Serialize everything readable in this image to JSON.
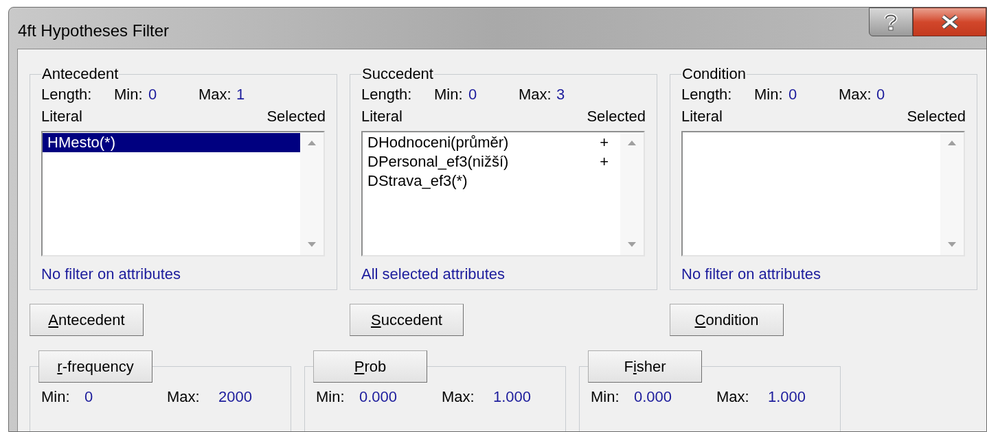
{
  "window": {
    "title": "4ft Hypotheses Filter"
  },
  "title_buttons": [
    {
      "kind": "help"
    },
    {
      "kind": "close"
    }
  ],
  "groups": [
    {
      "title": "Antecedent",
      "length_label": "Length:",
      "min_label": "Min:",
      "min": "0",
      "max_label": "Max:",
      "max": "1",
      "literal_header": "Literal",
      "selected_header": "Selected",
      "items": [
        {
          "literal": "HMesto(*)",
          "selected": true
        }
      ],
      "filter": "No filter on attributes",
      "button": {
        "key": "A",
        "after": "ntecedent"
      }
    },
    {
      "title": "Succedent",
      "length_label": "Length:",
      "min_label": "Min:",
      "min": "0",
      "max_label": "Max:",
      "max": "3",
      "literal_header": "Literal",
      "selected_header": "Selected",
      "items": [
        {
          "literal": "DHodnoceni(průměr)",
          "mark": "+",
          "selected": false
        },
        {
          "literal": "DPersonal_ef3(nižší)",
          "mark": "+",
          "selected": false
        },
        {
          "literal": "DStrava_ef3(*)",
          "selected": false
        }
      ],
      "filter": "All selected attributes",
      "button": {
        "key": "S",
        "after": "uccedent"
      }
    },
    {
      "title": "Condition",
      "length_label": "Length:",
      "min_label": "Min:",
      "min": "0",
      "max_label": "Max:",
      "max": "0",
      "literal_header": "Literal",
      "selected_header": "Selected",
      "filter": "No filter on attributes",
      "button": {
        "key": "C",
        "after": "ondition"
      }
    }
  ],
  "quantifiers": [
    {
      "button": {
        "key": "r",
        "after": "-frequency"
      },
      "min_label": "Min:",
      "min": "0",
      "max_label": "Max:",
      "max": "2000"
    },
    {
      "button": {
        "key": "P",
        "after": "rob"
      },
      "min_label": "Min:",
      "min": "0.000",
      "max_label": "Max:",
      "max": "1.000"
    },
    {
      "button": {
        "before": "F",
        "key": "i",
        "after": "sher"
      },
      "min_label": "Min:",
      "min": "0.000",
      "max_label": "Max:",
      "max": "1.000"
    }
  ]
}
